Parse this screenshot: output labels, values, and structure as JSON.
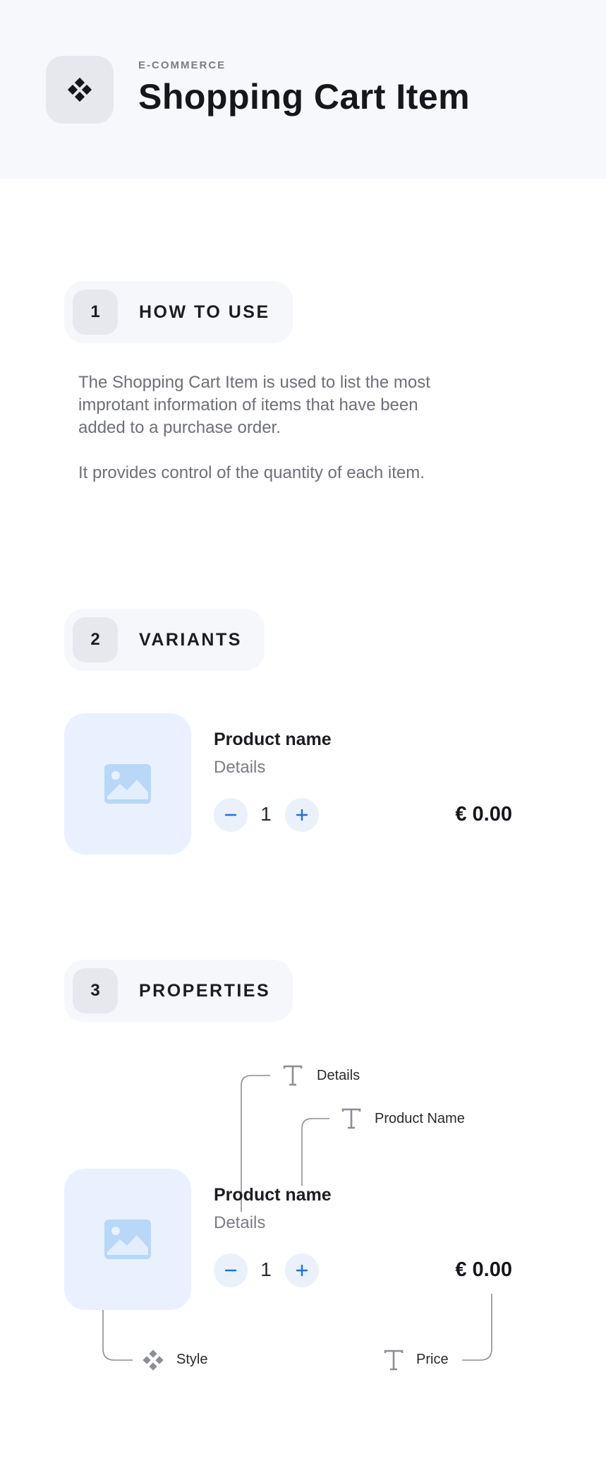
{
  "header": {
    "eyebrow": "E-COMMERCE",
    "title": "Shopping Cart Item",
    "icon": "component-diamond-icon"
  },
  "sections": [
    {
      "number": "1",
      "label": "HOW TO USE"
    },
    {
      "number": "2",
      "label": "VARIANTS"
    },
    {
      "number": "3",
      "label": "PROPERTIES"
    }
  ],
  "how_to_use": {
    "paragraphs": [
      "The Shopping Cart Item is used to list the most improtant information of items that have been added to a purchase order.",
      "It provides control of the quantity of each item."
    ]
  },
  "variant_item": {
    "product_name": "Product name",
    "details": "Details",
    "quantity": "1",
    "price": "€ 0.00",
    "image_icon": "image-placeholder-icon"
  },
  "properties_item": {
    "product_name": "Product name",
    "details": "Details",
    "quantity": "1",
    "price": "€ 0.00"
  },
  "annotations": {
    "details": "Details",
    "product_name": "Product Name",
    "style": "Style",
    "price": "Price"
  },
  "colors": {
    "accent": "#1a73e8",
    "image_placeholder": "#b9d7f7",
    "thumb_bg": "#e8f1fd",
    "header_bg": "#f7f8fc"
  }
}
